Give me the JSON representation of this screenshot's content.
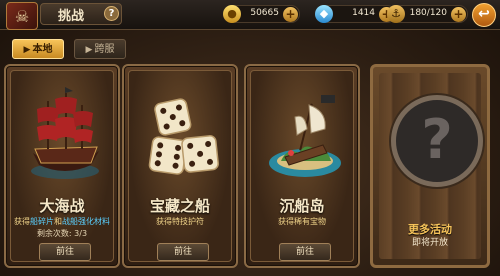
{
  "header": {
    "title": "挑战",
    "help": "?",
    "gold": "50665",
    "diamonds": "1414",
    "stamina": "180/120",
    "plus": "+"
  },
  "tabs": [
    {
      "label": "本地",
      "active": true
    },
    {
      "label": "跨服",
      "active": false
    }
  ],
  "cards": [
    {
      "title": "大海战",
      "desc_prefix": "获得",
      "desc_hl1": "船碎片",
      "desc_mid": "和",
      "desc_hl2": "战船强化材料",
      "extra": "剩余次数: 3/3",
      "button": "前往",
      "art": "pirate-ship"
    },
    {
      "title": "宝藏之船",
      "desc": "获得特技护符",
      "button": "前往",
      "art": "dice"
    },
    {
      "title": "沉船岛",
      "desc": "获得稀有宝物",
      "button": "前往",
      "art": "shipwreck-island"
    }
  ],
  "locked": {
    "title": "更多活动",
    "subtitle": "即将开放",
    "symbol": "?"
  },
  "colors": {
    "accent": "#f7c45a",
    "highlight": "#5ad0ff"
  }
}
